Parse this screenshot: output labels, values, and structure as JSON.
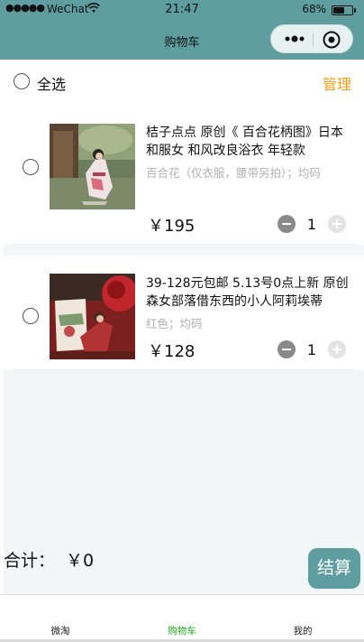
{
  "status_bar": {
    "signal": "●●●●●",
    "carrier": "WeChat",
    "time": "21:47",
    "battery": "68%",
    "battery_level": 0.68
  },
  "nav": {
    "title": "购物车"
  },
  "cart": {
    "select_all_label": "全选",
    "manage_label": "管理",
    "items": [
      {
        "title": "桔子点点 原创《 百合花柄图》日本和服女 和风改良浴衣 年轻款",
        "spec": "百合花（仅衣服，腰带另拍）；均码",
        "price": "￥195",
        "quantity": "1"
      },
      {
        "title": "39-128元包邮 5.13号0点上新 原创森女部落借东西的小人阿莉埃蒂",
        "spec": "红色；均码",
        "price": "￥128",
        "quantity": "1"
      }
    ]
  },
  "footer": {
    "total_label": "合计：",
    "total_amount": "￥0",
    "checkout_label": "结算"
  },
  "tabbar": {
    "tabs": [
      {
        "label": "微淘"
      },
      {
        "label": "购物车"
      },
      {
        "label": "我的"
      }
    ]
  },
  "colors": {
    "theme": "#5f9ea0",
    "manage": "#f39c12",
    "active_tab": "#1aad19"
  }
}
